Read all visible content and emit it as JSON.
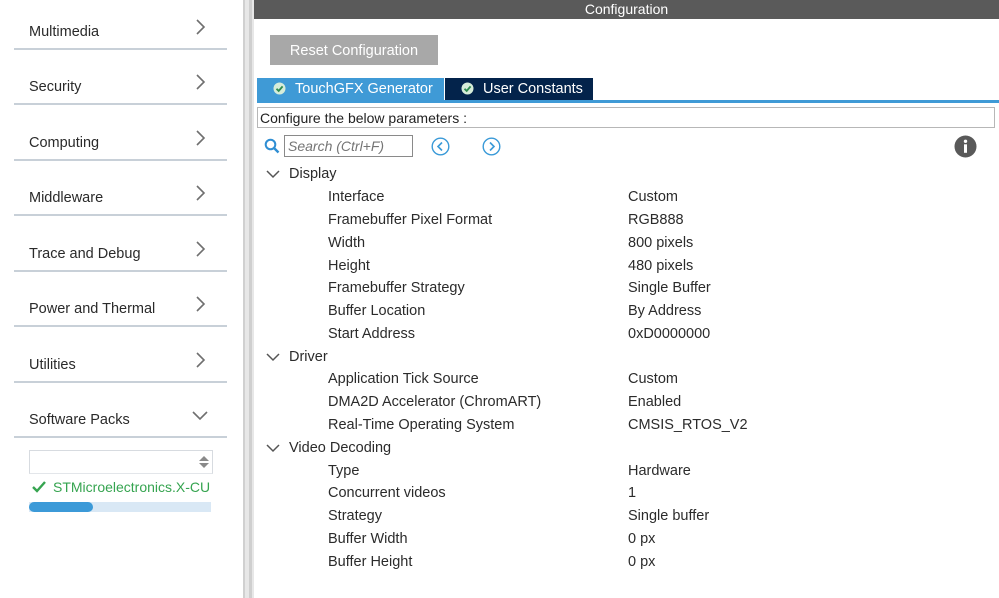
{
  "sidebar": {
    "categories": [
      {
        "label": "Multimedia"
      },
      {
        "label": "Security"
      },
      {
        "label": "Computing"
      },
      {
        "label": "Middleware"
      },
      {
        "label": "Trace and Debug"
      },
      {
        "label": "Power and Thermal"
      },
      {
        "label": "Utilities"
      },
      {
        "label": "Software Packs"
      }
    ],
    "pack_item": "STMicroelectronics.X-CU",
    "pack_progress": 0.35
  },
  "main": {
    "title": "Configuration",
    "reset_label": "Reset Configuration",
    "tabs": [
      {
        "label": "TouchGFX Generator"
      },
      {
        "label": "User Constants"
      }
    ],
    "description": "Configure the below parameters :",
    "search_placeholder": "Search (Ctrl+F)",
    "groups": [
      {
        "label": "Display",
        "params": [
          {
            "name": "Interface",
            "value": "Custom"
          },
          {
            "name": "Framebuffer Pixel Format",
            "value": "RGB888"
          },
          {
            "name": "Width",
            "value": "800 pixels"
          },
          {
            "name": "Height",
            "value": "480 pixels"
          },
          {
            "name": "Framebuffer Strategy",
            "value": "Single Buffer"
          },
          {
            "name": "Buffer Location",
            "value": "By Address"
          },
          {
            "name": "Start Address",
            "value": "0xD0000000"
          }
        ]
      },
      {
        "label": "Driver",
        "params": [
          {
            "name": "Application Tick Source",
            "value": "Custom"
          },
          {
            "name": "DMA2D Accelerator (ChromART)",
            "value": "Enabled"
          },
          {
            "name": "Real-Time Operating System",
            "value": "CMSIS_RTOS_V2"
          }
        ]
      },
      {
        "label": "Video Decoding",
        "params": [
          {
            "name": "Type",
            "value": "Hardware"
          },
          {
            "name": "Concurrent videos",
            "value": "1"
          },
          {
            "name": "Strategy",
            "value": "Single buffer"
          },
          {
            "name": "Buffer Width",
            "value": "0 px"
          },
          {
            "name": "Buffer Height",
            "value": "0 px"
          }
        ]
      }
    ]
  },
  "colors": {
    "accent": "#3f9ad6",
    "tab_dark": "#03234b",
    "titlebar": "#5a5a5a",
    "check_green": "#36a450"
  }
}
